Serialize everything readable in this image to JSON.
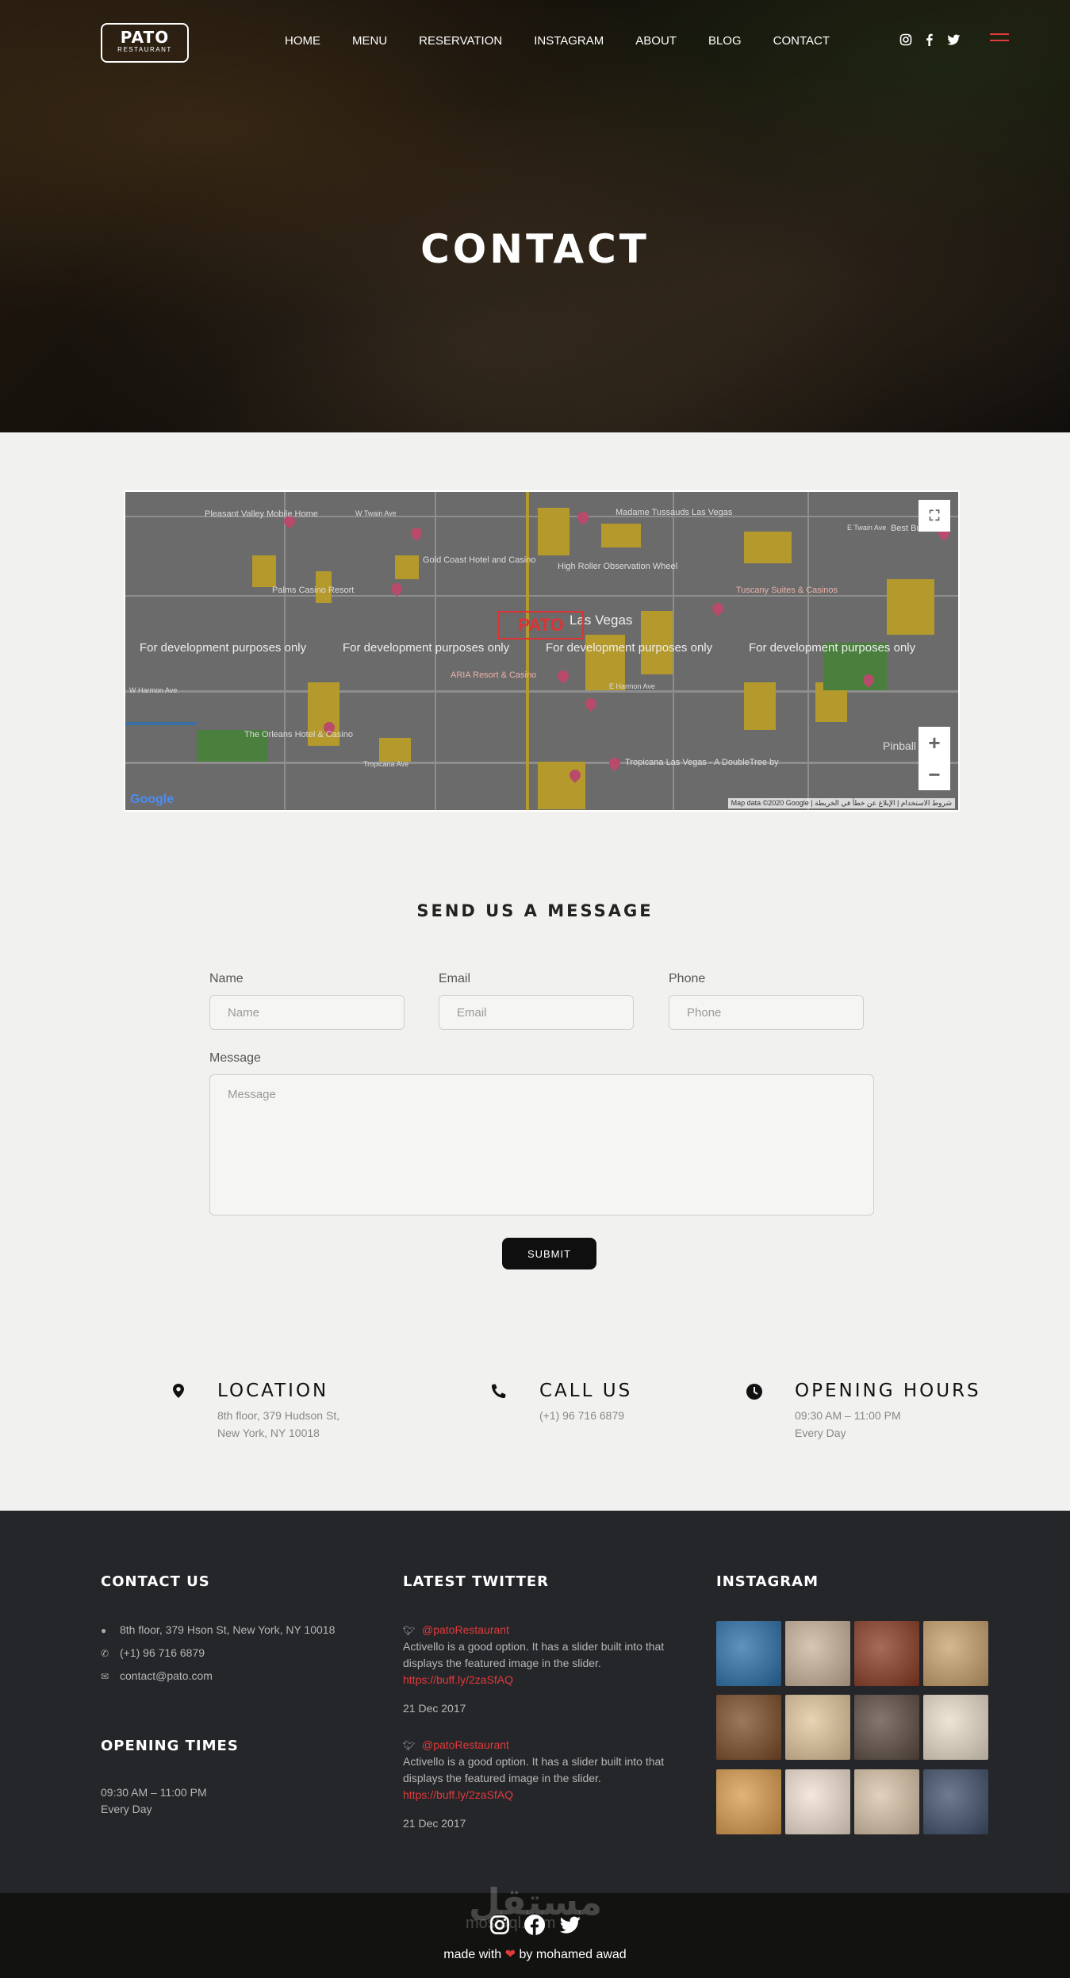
{
  "brand": {
    "name": "PATO",
    "sub": "RESTAURANT"
  },
  "nav": {
    "items": [
      "HOME",
      "MENU",
      "RESERVATION",
      "INSTAGRAM",
      "ABOUT",
      "BLOG",
      "CONTACT"
    ]
  },
  "social_icons": [
    "instagram-icon",
    "facebook-icon",
    "twitter-icon"
  ],
  "hero": {
    "title": "CONTACT"
  },
  "map": {
    "dev_text": "For development purposes only",
    "logo": "PATO",
    "google": "Google",
    "attribution": "Map data ©2020 Google | شروط الاستخدام | الإبلاغ عن خطأ في الخريطة",
    "labels": {
      "pleasant_valley": "Pleasant Valley Mobile Home",
      "gold_coast": "Gold Coast Hotel and Casino",
      "palms": "Palms Casino Resort",
      "madame": "Madame Tussauds Las Vegas",
      "high_roller": "High Roller Observation Wheel",
      "las_vegas": "Las Vegas",
      "tuscany": "Tuscany Suites & Casinos",
      "aria": "ARIA Resort & Casino",
      "orleans": "The Orleans Hotel & Casino",
      "tropicana": "Tropicana Las Vegas - A DoubleTree by",
      "pinball": "Pinball",
      "best_buy": "Best Bu",
      "w_twain": "W Twain Ave",
      "e_twain": "E Twain Ave",
      "e_harmon": "E Harmon Ave",
      "w_harmon": "W Harmon Ave",
      "tropicana_ave": "Tropicana Ave"
    }
  },
  "form": {
    "title": "SEND US A MESSAGE",
    "name_label": "Name",
    "name_placeholder": "Name",
    "email_label": "Email",
    "email_placeholder": "Email",
    "phone_label": "Phone",
    "phone_placeholder": "Phone",
    "message_label": "Message",
    "message_placeholder": "Message",
    "submit": "SUBMIT"
  },
  "info": {
    "location": {
      "title": "LOCATION",
      "line1": "8th floor, 379 Hudson St,",
      "line2": "New York, NY 10018"
    },
    "call": {
      "title": "CALL US",
      "line1": "(+1) 96 716 6879"
    },
    "hours": {
      "title": "OPENING HOURS",
      "line1": "09:30 AM – 11:00 PM",
      "line2": "Every Day"
    }
  },
  "footer": {
    "contact_title": "CONTACT US",
    "address": "8th floor, 379 Hson St, New York, NY 10018",
    "phone": "(+1) 96 716 6879",
    "email": "contact@pato.com",
    "opening_title": "OPENING TIMES",
    "opening_time": "09:30 AM – 11:00 PM",
    "opening_days": "Every Day",
    "twitter_title": "LATEST TWITTER",
    "tweets": [
      {
        "handle": "@patoRestaurant",
        "line1": "Activello is a good option. It has a slider built into that",
        "line2": "displays the featured image in the slider.",
        "link": "https://buff.ly/2zaSfAQ",
        "date": "21 Dec 2017"
      },
      {
        "handle": "@patoRestaurant",
        "line1": "Activello is a good option. It has a slider built into that",
        "line2": "displays the featured image in the slider.",
        "link": "https://buff.ly/2zaSfAQ",
        "date": "21 Dec 2017"
      }
    ],
    "instagram_title": "INSTAGRAM",
    "instagram_colors": [
      "#2a6fa8",
      "#c9b39a",
      "#8a3a22",
      "#c7a06a",
      "#7a4a26",
      "#e0c59a",
      "#5a4a40",
      "#e8dcc8",
      "#d89a4a",
      "#efe0cf",
      "#d8c2a6",
      "#3e4e68"
    ]
  },
  "bottom": {
    "watermark": "مستقل",
    "watermark_sub": "mostaql.com",
    "made_prefix": "made with",
    "made_suffix": "by mohamed awad"
  },
  "colors": {
    "accent": "#e23a3a",
    "footer_bg": "#25262a",
    "bottom_bg": "#121310"
  }
}
